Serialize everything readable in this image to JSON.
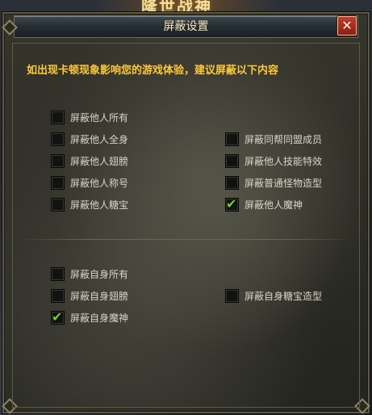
{
  "background": {
    "banner_text": "隆世战神"
  },
  "dialog": {
    "title": "屏蔽设置",
    "close_symbol": "✕",
    "notice": "如出现卡顿现象影响您的游戏体验，建议屏蔽以下内容"
  },
  "others": [
    {
      "id": "others-all",
      "label": "屏蔽他人所有",
      "checked": false
    },
    {
      "id": "others-body",
      "label": "屏蔽他人全身",
      "checked": false
    },
    {
      "id": "others-wings",
      "label": "屏蔽他人翅膀",
      "checked": false
    },
    {
      "id": "others-title",
      "label": "屏蔽他人称号",
      "checked": false
    },
    {
      "id": "others-pet",
      "label": "屏蔽他人糖宝",
      "checked": false
    },
    {
      "id": "guild-members",
      "label": "屏蔽同帮同盟成员",
      "checked": false
    },
    {
      "id": "others-skill-fx",
      "label": "屏蔽他人技能特效",
      "checked": false
    },
    {
      "id": "monster-model",
      "label": "屏蔽普通怪物造型",
      "checked": false
    },
    {
      "id": "others-demon",
      "label": "屏蔽他人魔神",
      "checked": true
    }
  ],
  "self": [
    {
      "id": "self-all",
      "label": "屏蔽自身所有",
      "checked": false
    },
    {
      "id": "self-wings",
      "label": "屏蔽自身翅膀",
      "checked": false
    },
    {
      "id": "self-demon",
      "label": "屏蔽自身魔神",
      "checked": true
    },
    {
      "id": "self-pet-model",
      "label": "屏蔽自身糖宝造型",
      "checked": false
    }
  ],
  "colors": {
    "notice": "#ffc83a",
    "check": "#6fd13a",
    "close_button": "#a92e21"
  },
  "icons": {
    "checkmark": "check-icon",
    "close": "close-icon"
  }
}
